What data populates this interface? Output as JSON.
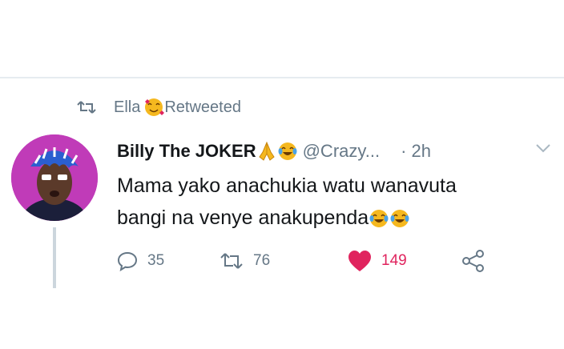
{
  "retweet_context": {
    "name": "Ella",
    "label": "Retweeted",
    "icon": "retweet-icon",
    "name_emoji": "smiling-face-with-hearts-emoji"
  },
  "tweet": {
    "display_name": "Billy The JOKER",
    "name_emojis": [
      "folded-hands-emoji",
      "face-with-tears-of-joy-emoji"
    ],
    "handle": "@Crazy...",
    "time": "· 2h",
    "text_line_1": "Mama yako anachukia watu wanavuta",
    "text_line_2": "bangi na venye anakupenda",
    "text_emojis": [
      "face-with-tears-of-joy-emoji",
      "face-with-tears-of-joy-emoji"
    ]
  },
  "actions": {
    "reply_count": "35",
    "retweet_count": "76",
    "like_count": "149",
    "like_color": "#e0245e"
  },
  "colors": {
    "secondary_text": "#657786",
    "primary_text": "#14171a",
    "avatar_bg": "#c03bb8"
  }
}
